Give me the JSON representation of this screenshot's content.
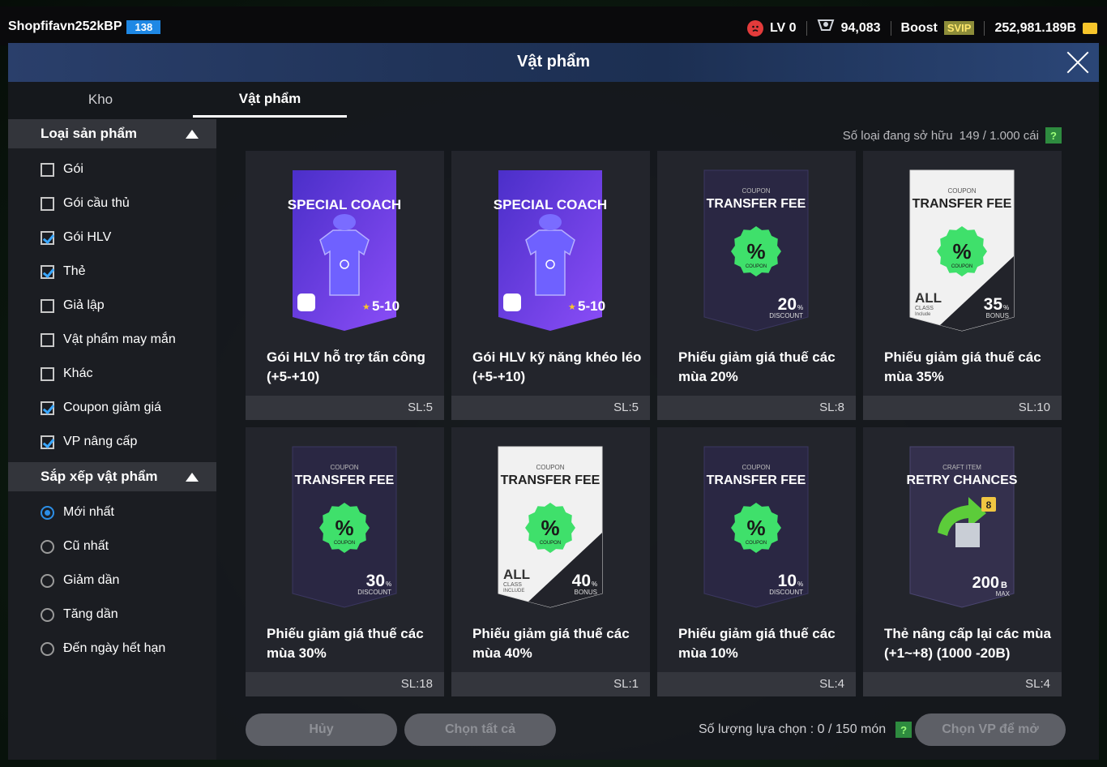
{
  "topbar": {
    "username": "Shopfifavn252kBP",
    "user_level": "138",
    "lv_label": "LV 0",
    "trophy_value": "94,083",
    "boost_label": "Boost",
    "svip_label": "SVIP",
    "bp_value": "252,981.189B"
  },
  "dialog": {
    "title": "Vật phẩm"
  },
  "tabs": [
    {
      "label": "Kho"
    },
    {
      "label": "Vật phẩm"
    }
  ],
  "filters": {
    "product_type": {
      "heading": "Loại sản phẩm",
      "options": [
        {
          "label": "Gói",
          "checked": false
        },
        {
          "label": "Gói cầu thủ",
          "checked": false
        },
        {
          "label": "Gói HLV",
          "checked": true
        },
        {
          "label": "Thẻ",
          "checked": true
        },
        {
          "label": "Giả lập",
          "checked": false
        },
        {
          "label": "Vật phẩm may mắn",
          "checked": false
        },
        {
          "label": "Khác",
          "checked": false
        },
        {
          "label": "Coupon giảm giá",
          "checked": true
        },
        {
          "label": "VP nâng cấp",
          "checked": true
        }
      ]
    },
    "sort": {
      "heading": "Sắp xếp vật phẩm",
      "options": [
        {
          "label": "Mới nhất",
          "selected": true
        },
        {
          "label": "Cũ nhất",
          "selected": false
        },
        {
          "label": "Giảm dần",
          "selected": false
        },
        {
          "label": "Tăng dần",
          "selected": false
        },
        {
          "label": "Đến ngày hết hạn",
          "selected": false
        }
      ]
    }
  },
  "owned": {
    "label": "Số loại đang sở hữu",
    "value": "149 / 1.000 cái",
    "help": "?"
  },
  "items": [
    {
      "name": "Gói HLV hỗ trợ tấn công (+5-+10)",
      "qty": "SL:5",
      "kind": "coach",
      "card_title": "SPECIAL COACH",
      "range": "5-10",
      "emblem": "shield-lock"
    },
    {
      "name": "Gói HLV kỹ năng khéo léo (+5-+10)",
      "qty": "SL:5",
      "kind": "coach",
      "card_title": "SPECIAL COACH",
      "range": "5-10",
      "emblem": "skill"
    },
    {
      "name": "Phiếu giảm giá thuế các mùa 20%",
      "qty": "SL:8",
      "kind": "coupon",
      "theme": "dark",
      "coupon_label": "COUPON",
      "card_title": "TRANSFER FEE",
      "percent": "20",
      "sub": "DISCOUNT"
    },
    {
      "name": "Phiếu giảm giá thuế các mùa 35%",
      "qty": "SL:10",
      "kind": "coupon",
      "theme": "white",
      "coupon_label": "COUPON",
      "card_title": "TRANSFER FEE",
      "percent": "35",
      "sub": "BONUS",
      "all_label": "ALL",
      "class_label": "CLASS",
      "include_label": "Include"
    },
    {
      "name": "Phiếu giảm giá thuế các mùa 30%",
      "qty": "SL:18",
      "kind": "coupon",
      "theme": "dark",
      "coupon_label": "COUPON",
      "card_title": "TRANSFER FEE",
      "percent": "30",
      "sub": "DISCOUNT"
    },
    {
      "name": "Phiếu giảm giá thuế các mùa 40%",
      "qty": "SL:1",
      "kind": "coupon",
      "theme": "white",
      "coupon_label": "COUPON",
      "card_title": "TRANSFER FEE",
      "percent": "40",
      "sub": "BONUS",
      "all_label": "ALL",
      "class_label": "CLASS",
      "include_label": "INCLUDE"
    },
    {
      "name": "Phiếu giảm giá thuế các mùa 10%",
      "qty": "SL:4",
      "kind": "coupon",
      "theme": "dark",
      "coupon_label": "COUPON",
      "card_title": "TRANSFER FEE",
      "percent": "10",
      "sub": "DISCOUNT"
    },
    {
      "name": "Thẻ nâng cấp lại các mùa (+1~+8) (1000 -20B)",
      "qty": "SL:4",
      "kind": "retry",
      "craft_label": "CRAFT ITEM",
      "card_title": "RETRY CHANCES",
      "badge": "8",
      "amount": "200",
      "amount_unit": "B",
      "max_label": "MAX"
    }
  ],
  "bottom": {
    "cancel_label": "Hủy",
    "select_all_label": "Chọn tất cả",
    "selection_label": "Số lượng lựa chọn : 0 / 150 món",
    "help": "?",
    "open_label": "Chọn VP để mở"
  },
  "colors": {
    "accent_blue": "#1e88e5",
    "checkbox_blue": "#3aa7ff",
    "coach_purple": "#6a3ef0",
    "coupon_green": "#3fe06b",
    "help_green": "#2e8b3f"
  }
}
